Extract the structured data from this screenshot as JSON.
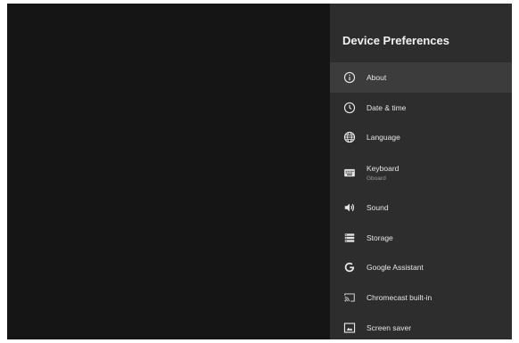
{
  "panel": {
    "title": "Device Preferences"
  },
  "menu": {
    "items": [
      {
        "label": "About",
        "icon": "info-icon",
        "selected": true
      },
      {
        "label": "Date & time",
        "icon": "clock-icon"
      },
      {
        "label": "Language",
        "icon": "globe-icon"
      },
      {
        "label": "Keyboard",
        "sublabel": "Gboard",
        "icon": "keyboard-icon"
      },
      {
        "label": "Sound",
        "icon": "speaker-icon"
      },
      {
        "label": "Storage",
        "icon": "storage-icon"
      },
      {
        "label": "Google Assistant",
        "icon": "google-g-icon"
      },
      {
        "label": "Chromecast built-in",
        "icon": "cast-icon"
      },
      {
        "label": "Screen saver",
        "icon": "screen-saver-icon"
      }
    ]
  },
  "colors": {
    "screen_background": "#151515",
    "panel_background": "#2d2d2d",
    "selected_item": "#3c3c3c",
    "text_primary": "#e6e6e6",
    "text_secondary": "#9a9a9a"
  }
}
